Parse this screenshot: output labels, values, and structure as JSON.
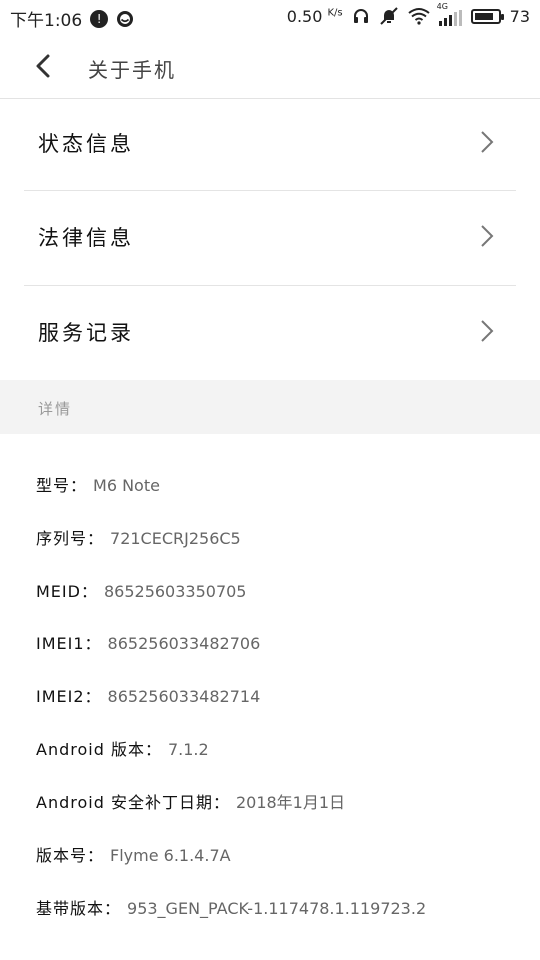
{
  "status_bar": {
    "time": "下午1:06",
    "net_speed": "0.50",
    "net_unit": "K/s",
    "network_type": "4G",
    "battery": "73",
    "icons": [
      "alert-circle-icon",
      "smiley-icon",
      "headphones-icon",
      "mute-icon",
      "wifi-icon",
      "signal-icon",
      "battery-icon"
    ]
  },
  "header": {
    "title": "关于手机"
  },
  "menu": [
    {
      "label": "状态信息"
    },
    {
      "label": "法律信息"
    },
    {
      "label": "服务记录"
    }
  ],
  "section": {
    "label": "详情"
  },
  "details": [
    {
      "key": "型号：",
      "value": "M6 Note"
    },
    {
      "key": "序列号：",
      "value": "721CECRJ256C5"
    },
    {
      "key": "MEID：",
      "value": "86525603350705"
    },
    {
      "key": "IMEI1：",
      "value": "865256033482706"
    },
    {
      "key": "IMEI2：",
      "value": "865256033482714"
    },
    {
      "key": "Android 版本：",
      "value": "7.1.2"
    },
    {
      "key": "Android 安全补丁日期：",
      "value": "2018年1月1日"
    },
    {
      "key": "版本号：",
      "value": "Flyme 6.1.4.7A"
    },
    {
      "key": "基带版本：",
      "value": "953_GEN_PACK-1.117478.1.119723.2"
    }
  ]
}
